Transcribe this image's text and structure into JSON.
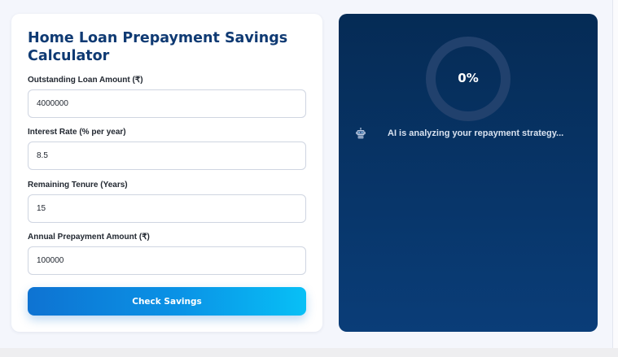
{
  "form": {
    "title": "Home Loan Prepayment Savings Calculator",
    "fields": [
      {
        "label": "Outstanding Loan Amount (₹)",
        "value": "4000000"
      },
      {
        "label": "Interest Rate (% per year)",
        "value": "8.5"
      },
      {
        "label": "Remaining Tenure (Years)",
        "value": "15"
      },
      {
        "label": "Annual Prepayment Amount (₹)",
        "value": "100000"
      }
    ],
    "submit_label": "Check Savings"
  },
  "result": {
    "progress_percent": 0,
    "progress_label": "0%",
    "status_icon": "robot-icon",
    "status_text": "AI is analyzing your repayment strategy..."
  },
  "colors": {
    "title": "#0f3a73",
    "panel_top": "#052b55",
    "panel_bottom": "#0a3d78",
    "button_start": "#0e73d2",
    "button_end": "#08c0f6"
  }
}
